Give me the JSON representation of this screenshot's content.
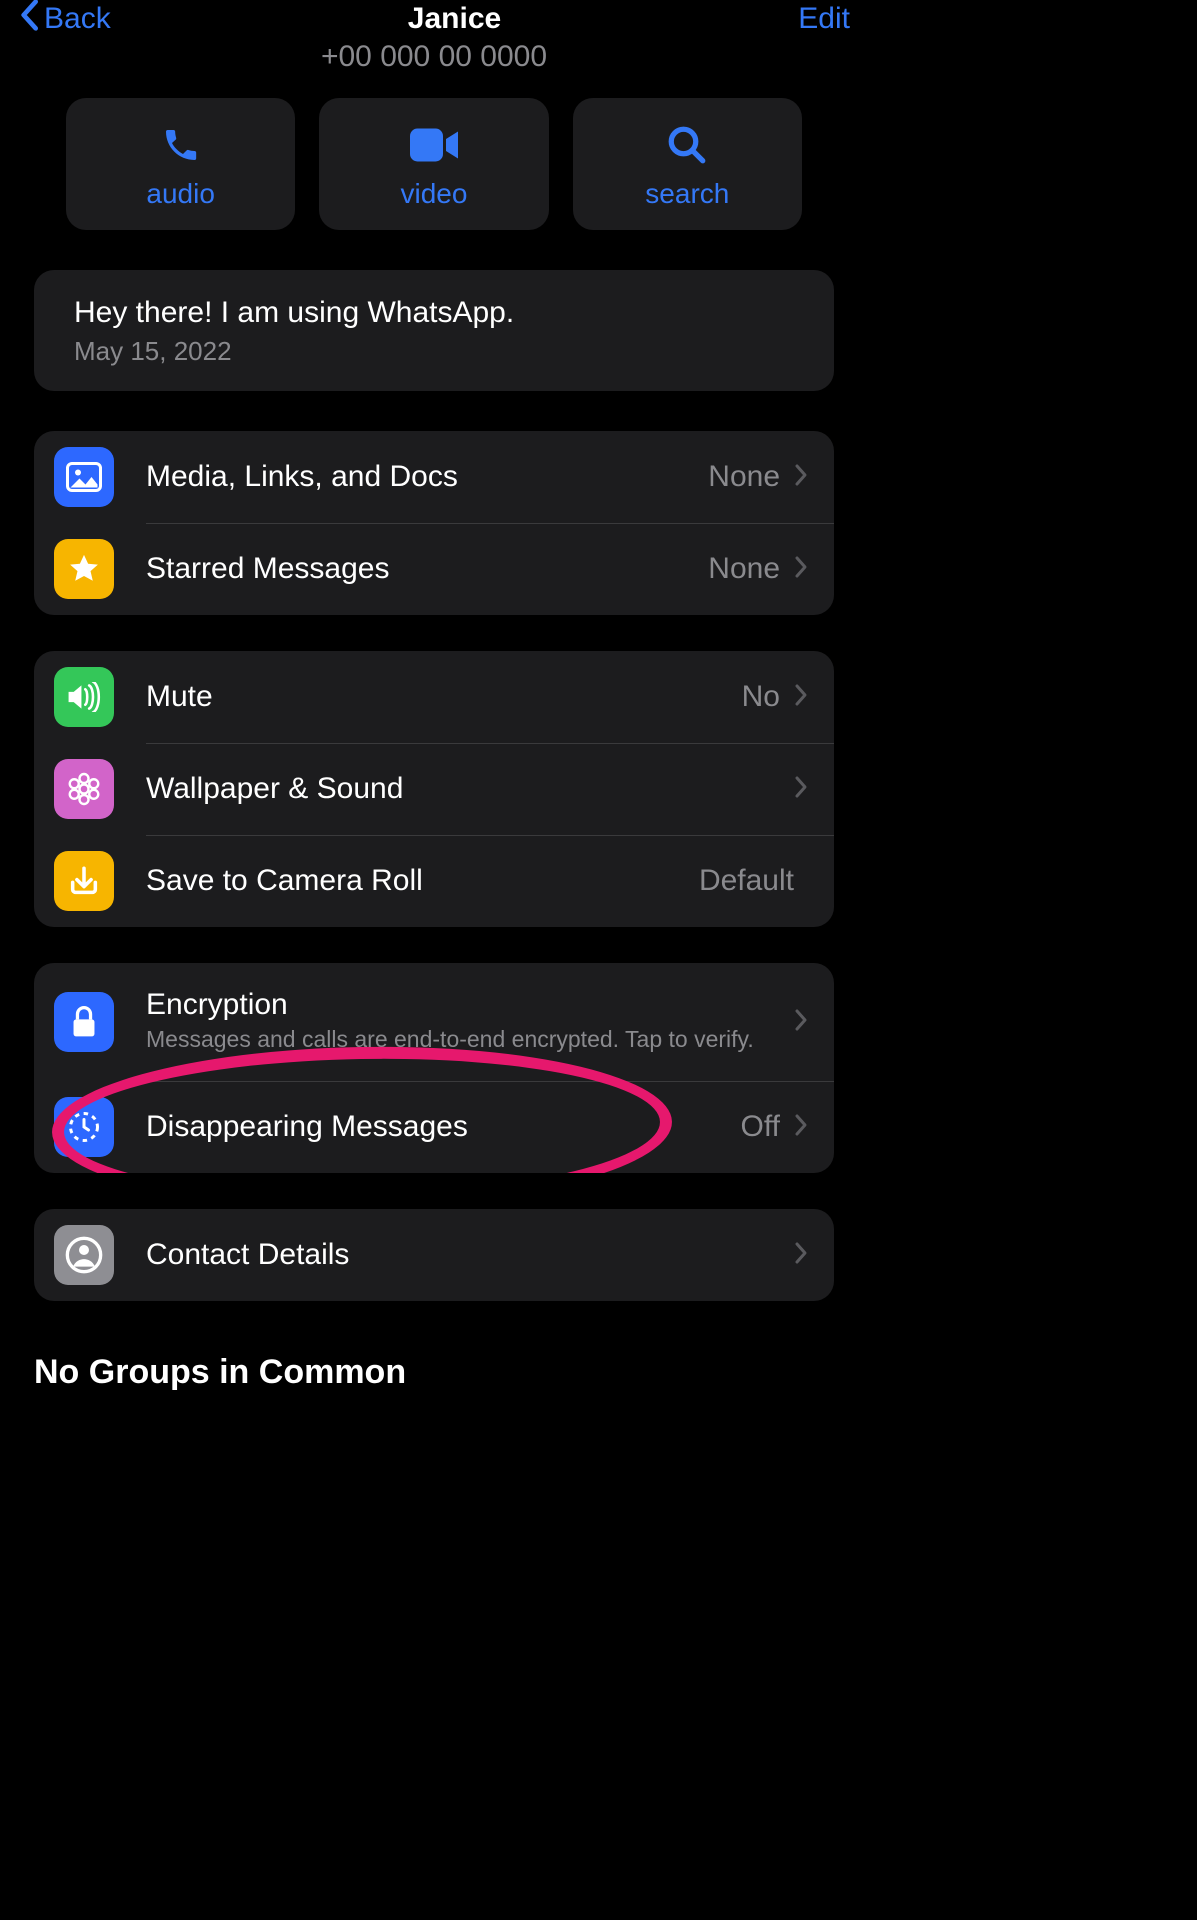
{
  "nav": {
    "back": "Back",
    "title": "Janice",
    "edit": "Edit"
  },
  "phone": "+00 000 00 0000",
  "actions": {
    "audio": "audio",
    "video": "video",
    "search": "search"
  },
  "status": {
    "text": "Hey there! I am using WhatsApp.",
    "date": "May 15, 2022"
  },
  "rows": {
    "media": {
      "label": "Media, Links, and Docs",
      "value": "None"
    },
    "starred": {
      "label": "Starred Messages",
      "value": "None"
    },
    "mute": {
      "label": "Mute",
      "value": "No"
    },
    "wallpaper": {
      "label": "Wallpaper & Sound"
    },
    "save": {
      "label": "Save to Camera Roll",
      "value": "Default"
    },
    "encryption": {
      "label": "Encryption",
      "sub": "Messages and calls are end-to-end encrypted. Tap to verify."
    },
    "disappearing": {
      "label": "Disappearing Messages",
      "value": "Off"
    },
    "contact": {
      "label": "Contact Details"
    }
  },
  "section": "No Groups in Common"
}
